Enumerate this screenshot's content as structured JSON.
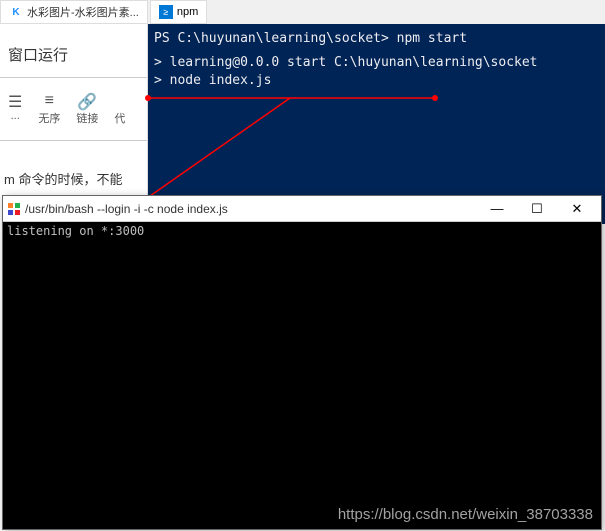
{
  "tabs": {
    "left": "水彩图片-水彩图片素...",
    "right": "npm"
  },
  "leftPanel": {
    "title": "窗口运行",
    "tools": [
      {
        "icon": "☰",
        "label": "..."
      },
      {
        "icon": "≡",
        "label": "无序"
      },
      {
        "icon": "🔗",
        "label": "链接"
      },
      {
        "icon": "",
        "label": "代"
      }
    ],
    "bodyText": "m 命令的时候，不能"
  },
  "psWindow": {
    "line1": "PS C:\\huyunan\\learning\\socket> npm start",
    "line2": "> learning@0.0.0 start C:\\huyunan\\learning\\socket",
    "line3": "> node index.js"
  },
  "bashWindow": {
    "title": "/usr/bin/bash --login -i -c node index.js",
    "output": "listening on *:3000",
    "controls": {
      "min": "—",
      "max": "☐",
      "close": "✕"
    }
  },
  "watermark": "https://blog.csdn.net/weixin_38703338"
}
